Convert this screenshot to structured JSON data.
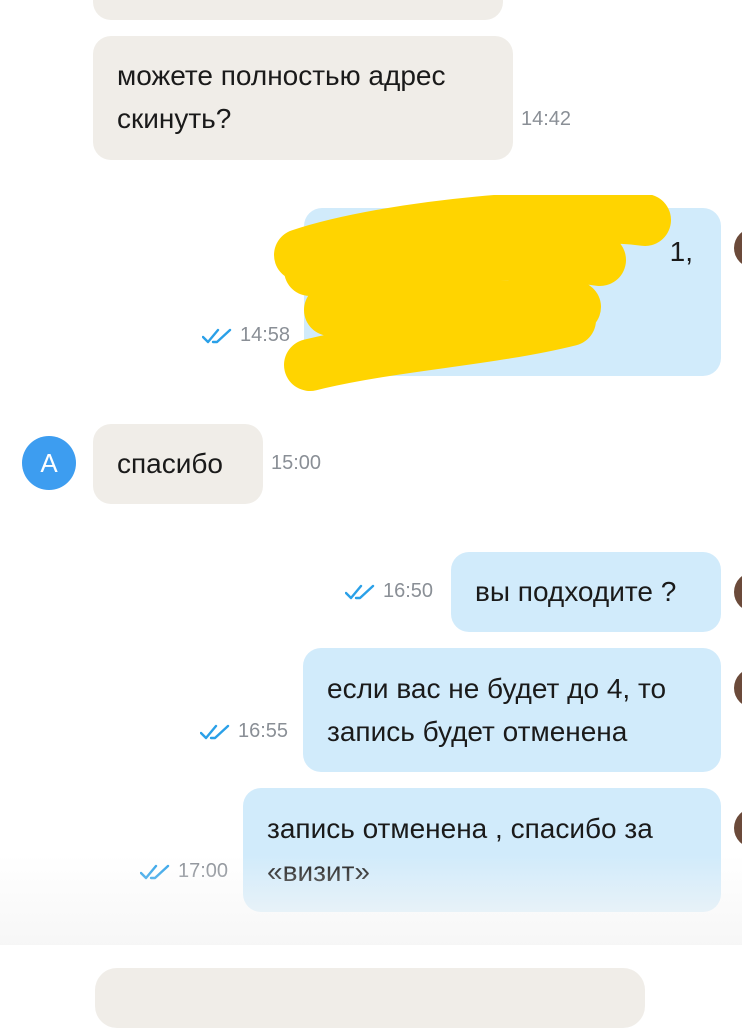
{
  "messages": [
    {
      "direction": "incoming",
      "text": "",
      "time": ""
    },
    {
      "direction": "incoming",
      "text": "можете полностью адрес\nскинуть?",
      "time": "14:42"
    },
    {
      "direction": "outgoing",
      "text": "1,",
      "time": "14:58",
      "read": true,
      "redacted": true
    },
    {
      "direction": "incoming",
      "text": "спасибо",
      "time": "15:00",
      "sender_initial": "А"
    },
    {
      "direction": "outgoing",
      "text": "вы подходите ?",
      "time": "16:50",
      "read": true
    },
    {
      "direction": "outgoing",
      "text": "если вас не будет до 4, то\nзапись будет отменена",
      "time": "16:55",
      "read": true
    },
    {
      "direction": "outgoing",
      "text": "запись отменена , спасибо за\n«визит»",
      "time": "17:00",
      "read": true
    }
  ],
  "colors": {
    "incoming_bubble": "#f0ede8",
    "outgoing_bubble": "#d1ebfb",
    "avatar": "#3d9df0",
    "read_check": "#2aa0e8",
    "time_text": "#8a8f96",
    "redaction": "#ffd400"
  },
  "icons": {
    "read_status": "double-check-icon"
  }
}
